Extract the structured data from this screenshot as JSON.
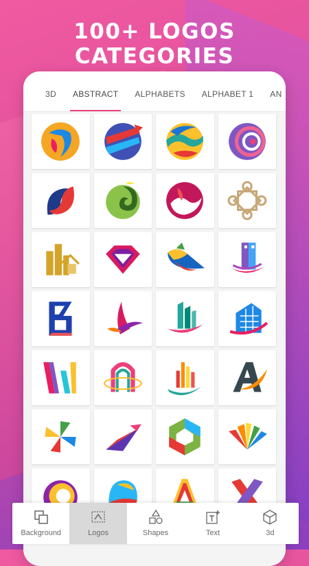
{
  "headline": "100+ LOGOS CATEGORIES",
  "tabs": [
    {
      "label": "3D"
    },
    {
      "label": "ABSTRACT"
    },
    {
      "label": "ALPHABETS"
    },
    {
      "label": "ALPHABET 1"
    },
    {
      "label": "AN"
    }
  ],
  "active_tab": "ABSTRACT",
  "logos": [
    "swirl-circle-logo",
    "arrow-sphere-logo",
    "wave-sphere-logo",
    "striped-sphere-logo",
    "ribbon-s-logo",
    "green-swirl-logo",
    "red-flame-circle-logo",
    "celtic-knot-logo",
    "gold-buildings-logo",
    "diamond-logo",
    "bird-wing-logo",
    "building-swoosh-logo",
    "letter-b-logo",
    "phoenix-bird-logo",
    "towers-ring-logo",
    "glass-building-logo",
    "stripes-w-logo",
    "arch-orbit-logo",
    "city-bars-logo",
    "letter-a-swoosh-logo",
    "pinwheel-logo",
    "paper-plane-logo",
    "hexagon-ring-logo",
    "petal-fan-logo",
    "ring-c-logo",
    "colorful-egg-logo",
    "rainbow-a-logo",
    "letter-x-logo"
  ],
  "bottom_nav": [
    {
      "label": "Background",
      "icon": "background-layers-icon"
    },
    {
      "label": "Logos",
      "icon": "logos-icon"
    },
    {
      "label": "Shapes",
      "icon": "shapes-icon"
    },
    {
      "label": "Text",
      "icon": "text-add-icon"
    },
    {
      "label": "3d",
      "icon": "cube-3d-icon"
    }
  ],
  "active_nav": "Logos",
  "colors": {
    "accent": "#ec407a"
  }
}
